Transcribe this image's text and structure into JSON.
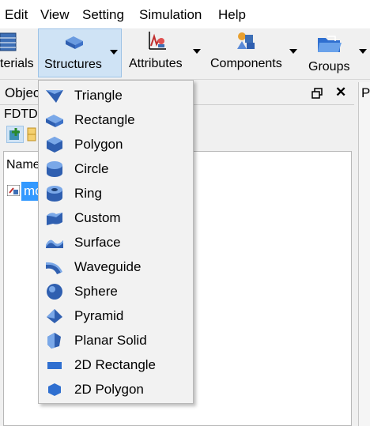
{
  "menubar": {
    "items": [
      {
        "id": "edit",
        "label": "Edit"
      },
      {
        "id": "view",
        "label": "View"
      },
      {
        "id": "setting",
        "label": "Setting"
      },
      {
        "id": "simulation",
        "label": "Simulation"
      },
      {
        "id": "help",
        "label": "Help"
      }
    ]
  },
  "toolbar": {
    "materials_label": "terials",
    "structures_label": "Structures",
    "attributes_label": "Attributes",
    "components_label": "Components",
    "groups_label": "Groups"
  },
  "objects_panel": {
    "title": "Objec",
    "restore_icon": "window-restore-icon",
    "close_label": "✕",
    "sub_label": "FDTD",
    "column_header": "Name",
    "tree_item_label": "mo"
  },
  "right_panel": {
    "title_fragment": "P"
  },
  "structures_menu": {
    "items": [
      {
        "label": "Triangle",
        "icon": "triangle-icon"
      },
      {
        "label": "Rectangle",
        "icon": "rectangle-icon"
      },
      {
        "label": "Polygon",
        "icon": "polygon-icon"
      },
      {
        "label": "Circle",
        "icon": "circle-icon"
      },
      {
        "label": "Ring",
        "icon": "ring-icon"
      },
      {
        "label": "Custom",
        "icon": "custom-icon"
      },
      {
        "label": "Surface",
        "icon": "surface-icon"
      },
      {
        "label": "Waveguide",
        "icon": "waveguide-icon"
      },
      {
        "label": "Sphere",
        "icon": "sphere-icon"
      },
      {
        "label": "Pyramid",
        "icon": "pyramid-icon"
      },
      {
        "label": "Planar Solid",
        "icon": "planar-solid-icon"
      },
      {
        "label": "2D Rectangle",
        "icon": "2d-rectangle-icon"
      },
      {
        "label": "2D Polygon",
        "icon": "2d-polygon-icon"
      }
    ]
  },
  "colors": {
    "accent_blue": "#2f6fd0",
    "toolbar_active": "#cfe3f5",
    "selection": "#3399ff"
  }
}
